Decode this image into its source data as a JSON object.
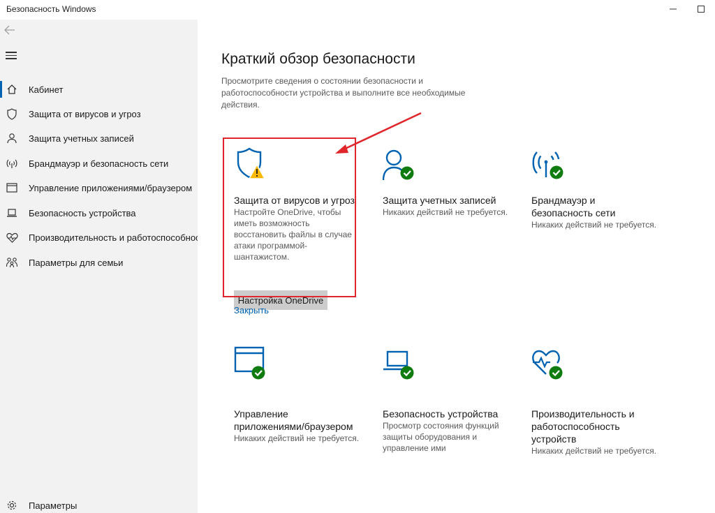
{
  "window": {
    "title": "Безопасность Windows"
  },
  "sidebar": {
    "items": [
      {
        "label": "Кабинет",
        "icon": "home-icon",
        "selected": true
      },
      {
        "label": "Защита от вирусов и угроз",
        "icon": "shield-icon"
      },
      {
        "label": "Защита учетных записей",
        "icon": "person-icon"
      },
      {
        "label": "Брандмауэр и безопасность сети",
        "icon": "wifi-icon"
      },
      {
        "label": "Управление приложениями/браузером",
        "icon": "browser-icon"
      },
      {
        "label": "Безопасность устройства",
        "icon": "laptop-icon"
      },
      {
        "label": "Производительность и работоспособность",
        "icon": "heart-icon"
      },
      {
        "label": "Параметры для семьи",
        "icon": "family-icon"
      }
    ],
    "settings_label": "Параметры"
  },
  "main": {
    "title": "Краткий обзор безопасности",
    "description": "Просмотрите сведения о состоянии безопасности и работоспособности устройства и выполните все необходимые действия.",
    "cards": [
      {
        "title": "Защита от вирусов и угроз",
        "desc": "Настройте OneDrive, чтобы иметь возможность восстановить файлы в случае атаки программой-шантажистом.",
        "button": "Настройка OneDrive",
        "link": "Закрыть",
        "status": "warning"
      },
      {
        "title": "Защита учетных записей",
        "desc": "Никаких действий не требуется.",
        "status": "ok"
      },
      {
        "title": "Брандмауэр и безопасность сети",
        "desc": "Никаких действий не требуется.",
        "status": "ok"
      },
      {
        "title": "Управление приложениями/браузером",
        "desc": "Никаких действий не требуется.",
        "status": "ok"
      },
      {
        "title": "Безопасность устройства",
        "desc": "Просмотр состояния функций защиты оборудования и управление ими",
        "status": "ok"
      },
      {
        "title": "Производительность и работоспособность устройств",
        "desc": "Никаких действий не требуется.",
        "status": "ok"
      }
    ]
  },
  "colors": {
    "accent": "#0063b1",
    "ok": "#107c10",
    "warning": "#ffb900",
    "annotation": "#e0262a"
  }
}
